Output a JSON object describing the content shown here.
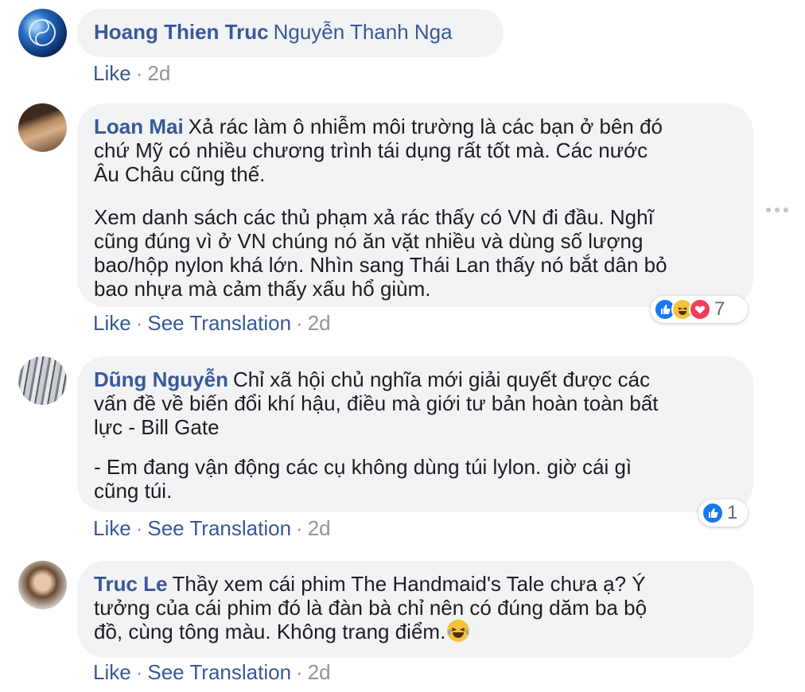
{
  "comments": [
    {
      "author": "Hoang Thien Truc",
      "lines": [
        "Nguyễn Thanh Nga"
      ],
      "paragraph2": [],
      "like": "Like",
      "translate": "",
      "time": "2d"
    },
    {
      "author": "Loan Mai",
      "lines": [
        "Xả rác làm ô nhiễm môi trường là các bạn ở bên đó",
        "chứ Mỹ có nhiều chương trình tái dụng rất tốt mà. Các nước",
        "Âu Châu cũng thế."
      ],
      "paragraph2": [
        "Xem danh sách các thủ phạm xả rác thấy có VN đi đầu. Nghĩ",
        "cũng đúng vì ở VN chúng nó ăn vặt nhiều và dùng số lượng",
        "bao/hộp nylon khá lớn. Nhìn sang Thái Lan thấy nó bắt dân bỏ",
        "bao nhựa mà cảm thấy xấu hổ giùm."
      ],
      "like": "Like",
      "translate": "See Translation",
      "time": "2d",
      "reaction_count": "7"
    },
    {
      "author": "Dũng Nguyễn",
      "lines": [
        "Chỉ xã hội chủ nghĩa mới giải quyết được các",
        "vấn đề về biến đổi khí hậu, điều mà giới tư bản hoàn toàn bất",
        "lực - Bill Gate"
      ],
      "paragraph2": [
        "- Em đang vận động các cụ không dùng túi lylon. giờ cái gì",
        "cũng túi."
      ],
      "like": "Like",
      "translate": "See Translation",
      "time": "2d",
      "reaction_count": "1"
    },
    {
      "author": "Truc Le",
      "lines": [
        "Thầy xem cái phim The Handmaid's Tale chưa ạ? Ý",
        "tưởng của cái phim đó là đàn bà chỉ nên có đúng dăm ba bộ",
        "đồ, cùng tông màu. Không trang điểm."
      ],
      "paragraph2": [],
      "like": "Like",
      "translate": "See Translation",
      "time": "2d"
    }
  ],
  "colors": {
    "link": "#385898",
    "bubble": "#f2f3f5",
    "meta_grey": "#90949c"
  },
  "icons": [
    "like-reaction-icon",
    "haha-reaction-icon",
    "love-reaction-icon",
    "more-options-icon",
    "laughing-emoji-icon"
  ]
}
